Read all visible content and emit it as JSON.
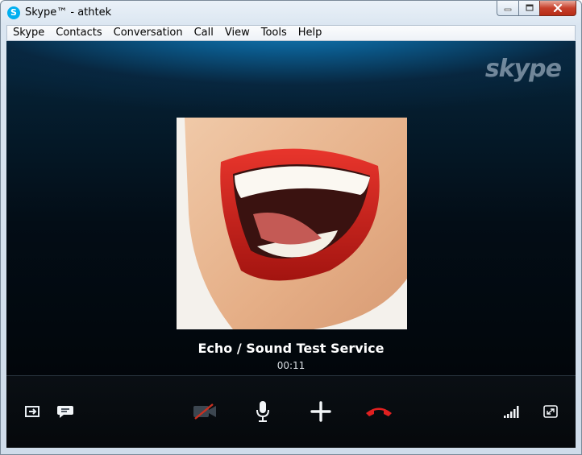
{
  "window": {
    "title": "Skype™ - athtek",
    "app_icon_letter": "S"
  },
  "menu": {
    "items": [
      "Skype",
      "Contacts",
      "Conversation",
      "Call",
      "View",
      "Tools",
      "Help"
    ]
  },
  "call": {
    "brand_logo": "skype",
    "caller_name": "Echo / Sound Test Service",
    "duration": "00:11"
  },
  "controls": {
    "left": [
      "send-file-icon",
      "chat-icon"
    ],
    "center": [
      "video-off-icon",
      "microphone-icon",
      "plus-icon",
      "hang-up-icon"
    ],
    "right": [
      "signal-strength-icon",
      "fullscreen-icon"
    ]
  },
  "colors": {
    "hang_up": "#e02020",
    "video_off_slash": "#c83020",
    "skype_blue": "#00aff0"
  }
}
